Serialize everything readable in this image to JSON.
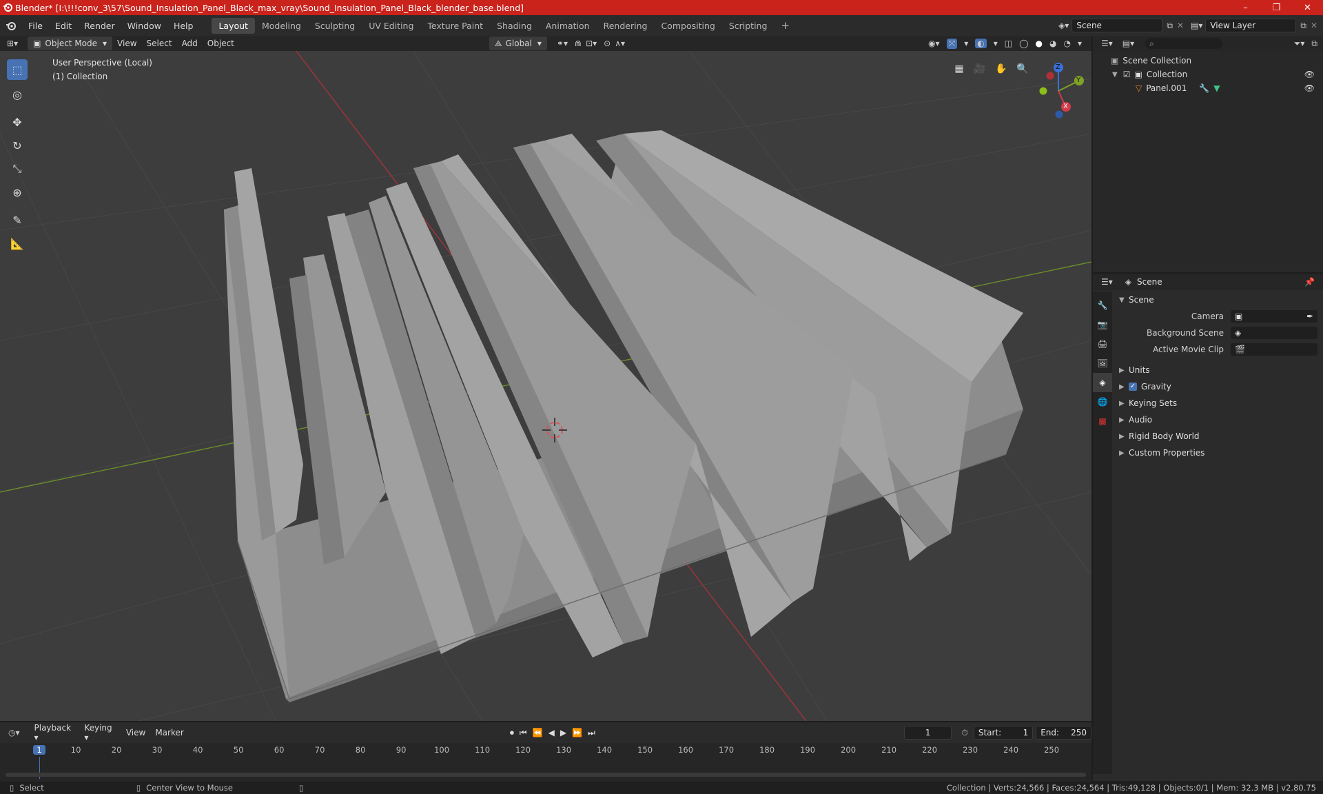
{
  "window": {
    "title": "Blender* [I:\\!!!conv_3\\57\\Sound_Insulation_Panel_Black_max_vray\\Sound_Insulation_Panel_Black_blender_base.blend]",
    "minimize": "–",
    "maximize": "❐",
    "close": "✕"
  },
  "menu": [
    "File",
    "Edit",
    "Render",
    "Window",
    "Help"
  ],
  "workspaces": [
    "Layout",
    "Modeling",
    "Sculpting",
    "UV Editing",
    "Texture Paint",
    "Shading",
    "Animation",
    "Rendering",
    "Compositing",
    "Scripting"
  ],
  "active_workspace": "Layout",
  "scene_field": "Scene",
  "view_layer_field": "View Layer",
  "viewport_header": {
    "mode": "Object Mode",
    "menus": [
      "View",
      "Select",
      "Add",
      "Object"
    ],
    "orientation": "Global"
  },
  "viewport": {
    "perspective_label": "User Perspective (Local)",
    "collection_label": "(1) Collection",
    "gizmo_axes": {
      "z": "Z",
      "y": "Y",
      "x": "X"
    }
  },
  "outliner": {
    "scene_collection": "Scene Collection",
    "collection": "Collection",
    "object": "Panel.001"
  },
  "properties": {
    "header": "Scene",
    "panel_scene": "Scene",
    "camera_label": "Camera",
    "background_scene_label": "Background Scene",
    "active_movie_clip_label": "Active Movie Clip",
    "panels": [
      "Units",
      "Gravity",
      "Keying Sets",
      "Audio",
      "Rigid Body World",
      "Custom Properties"
    ],
    "gravity_checked": true
  },
  "timeline": {
    "menus": [
      "Playback",
      "Keying",
      "View",
      "Marker"
    ],
    "current_frame": "1",
    "start_label": "Start:",
    "start": "1",
    "end_label": "End:",
    "end": "250",
    "ruler": [
      "1",
      "10",
      "20",
      "30",
      "40",
      "50",
      "60",
      "70",
      "80",
      "90",
      "100",
      "110",
      "120",
      "130",
      "140",
      "150",
      "160",
      "170",
      "180",
      "190",
      "200",
      "210",
      "220",
      "230",
      "240",
      "250"
    ]
  },
  "statusbar": {
    "select": "Select",
    "center_view": "Center View to Mouse",
    "stats": "Collection | Verts:24,566 | Faces:24,564 | Tris:49,128 | Objects:0/1 | Mem: 32.3 MB | v2.80.75"
  },
  "colors": {
    "titlebar": "#c9231c",
    "accent": "#4772b3",
    "viewport_bg": "#3d3d3d"
  }
}
